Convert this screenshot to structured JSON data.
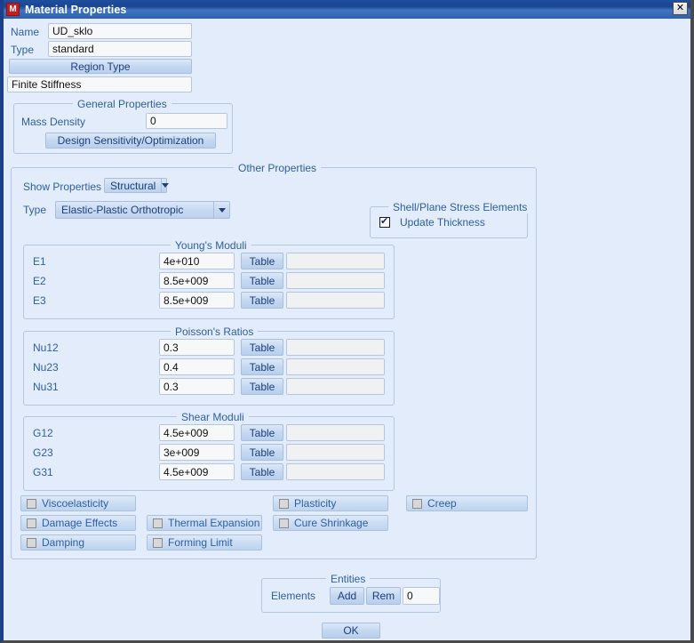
{
  "window": {
    "title": "Material Properties",
    "icon": "M",
    "close_label": "✕"
  },
  "header": {
    "name_label": "Name",
    "name_value": "UD_sklo",
    "type_label": "Type",
    "type_value": "standard",
    "region_type_button": "Region Type",
    "region_type_value": "Finite Stiffness"
  },
  "general_properties": {
    "legend": "General Properties",
    "mass_density_label": "Mass Density",
    "mass_density_value": "0",
    "design_sensitivity_button": "Design Sensitivity/Optimization"
  },
  "other_properties": {
    "legend": "Other Properties",
    "show_properties_label": "Show Properties",
    "show_properties_value": "Structural",
    "type_label": "Type",
    "type_value": "Elastic-Plastic Orthotropic"
  },
  "shell_plane": {
    "legend": "Shell/Plane Stress Elements",
    "update_thickness_label": "Update Thickness",
    "update_thickness_checked": true
  },
  "youngs_moduli": {
    "legend": "Young's Moduli",
    "table_button": "Table",
    "rows": [
      {
        "label": "E1",
        "value": "4e+010",
        "extra": ""
      },
      {
        "label": "E2",
        "value": "8.5e+009",
        "extra": ""
      },
      {
        "label": "E3",
        "value": "8.5e+009",
        "extra": ""
      }
    ]
  },
  "poissons_ratios": {
    "legend": "Poisson's Ratios",
    "table_button": "Table",
    "rows": [
      {
        "label": "Nu12",
        "value": "0.3",
        "extra": ""
      },
      {
        "label": "Nu23",
        "value": "0.4",
        "extra": ""
      },
      {
        "label": "Nu31",
        "value": "0.3",
        "extra": ""
      }
    ]
  },
  "shear_moduli": {
    "legend": "Shear Moduli",
    "table_button": "Table",
    "rows": [
      {
        "label": "G12",
        "value": "4.5e+009",
        "extra": ""
      },
      {
        "label": "G23",
        "value": "3e+009",
        "extra": ""
      },
      {
        "label": "G31",
        "value": "4.5e+009",
        "extra": ""
      }
    ]
  },
  "option_toggles": [
    {
      "label": "Viscoelasticity",
      "checked": false
    },
    {
      "label": "Plasticity",
      "checked": false
    },
    {
      "label": "Creep",
      "checked": false
    },
    {
      "label": "Damage Effects",
      "checked": false
    },
    {
      "label": "Thermal Expansion",
      "checked": false
    },
    {
      "label": "Cure Shrinkage",
      "checked": false
    },
    {
      "label": "Damping",
      "checked": false
    },
    {
      "label": "Forming Limit",
      "checked": false
    }
  ],
  "entities": {
    "legend": "Entities",
    "elements_label": "Elements",
    "add_button": "Add",
    "rem_button": "Rem",
    "count_value": "0"
  },
  "footer": {
    "ok_button": "OK"
  },
  "colors": {
    "dialog_bg": "#e2ecfa",
    "titlebar": "#1f4fa0",
    "accent_text": "#2e5fa3",
    "icon_red": "#c02020"
  }
}
